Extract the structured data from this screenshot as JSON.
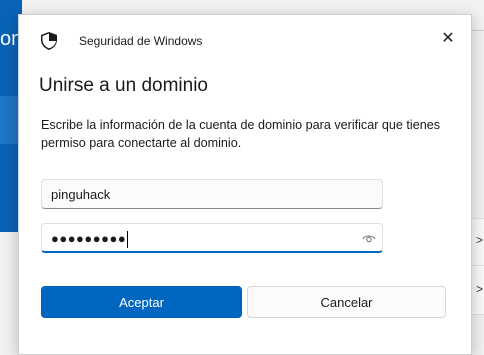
{
  "background": {
    "window_title_fragment": "omi",
    "chevrons": [
      ">",
      ">"
    ]
  },
  "dialog": {
    "app_name": "Seguridad de Windows",
    "close_glyph": "✕",
    "heading": "Unirse a un dominio",
    "description": "Escribe la información de la cuenta de dominio para verificar que tienes permiso para conectarte al dominio.",
    "username": {
      "value": "pinguhack"
    },
    "password": {
      "masked_value": "●●●●●●●●●",
      "reveal_icon": "eye-icon"
    },
    "buttons": {
      "accept": "Aceptar",
      "cancel": "Cancelar"
    }
  },
  "colors": {
    "accent": "#0067c0",
    "background_band": "#0a63b8"
  }
}
